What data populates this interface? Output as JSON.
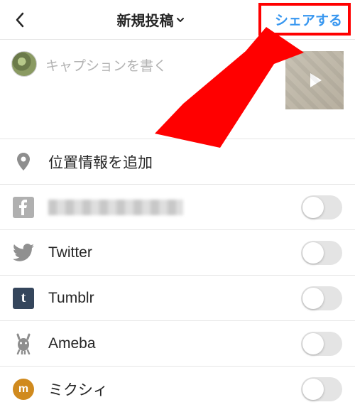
{
  "header": {
    "title": "新規投稿",
    "share_label": "シェアする"
  },
  "caption": {
    "placeholder": "キャプションを書く"
  },
  "location_row": {
    "label": "位置情報を追加"
  },
  "share_services": [
    {
      "id": "facebook",
      "label": "",
      "enabled": false,
      "label_hidden": true
    },
    {
      "id": "twitter",
      "label": "Twitter",
      "enabled": false
    },
    {
      "id": "tumblr",
      "label": "Tumblr",
      "enabled": false
    },
    {
      "id": "ameba",
      "label": "Ameba",
      "enabled": false
    },
    {
      "id": "mixi",
      "label": "ミクシィ",
      "enabled": false
    }
  ],
  "colors": {
    "accent": "#3897f0",
    "annotation": "#ff0000"
  }
}
